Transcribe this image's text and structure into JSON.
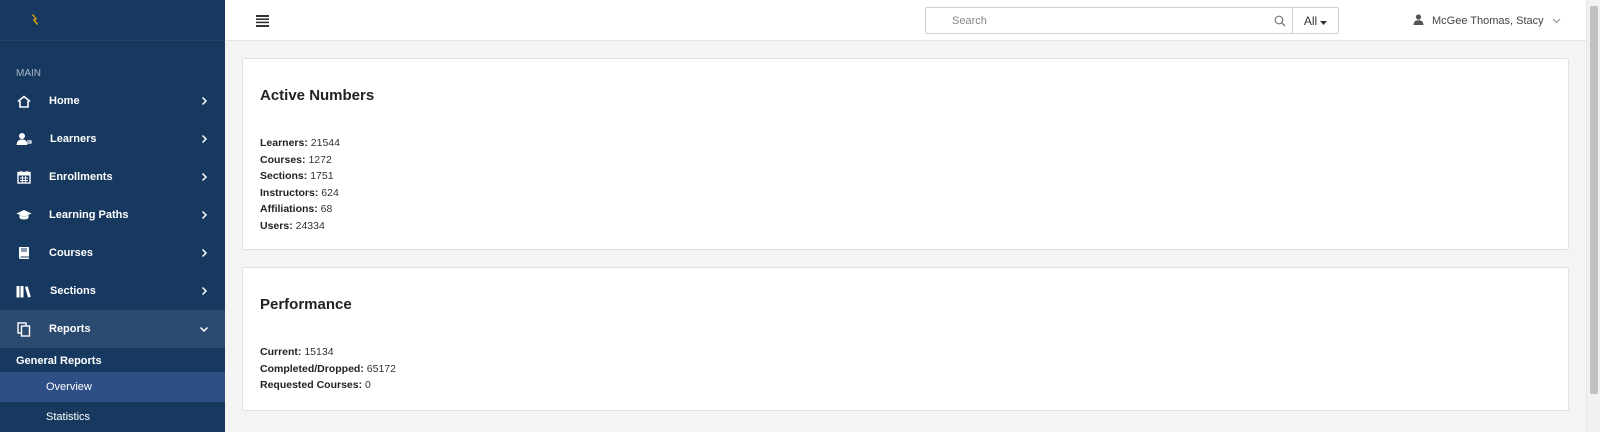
{
  "sidebar": {
    "section_label": "MAIN",
    "items": [
      {
        "label": "Home",
        "icon": "home-icon"
      },
      {
        "label": "Learners",
        "icon": "learner-icon"
      },
      {
        "label": "Enrollments",
        "icon": "calendar-icon"
      },
      {
        "label": "Learning Paths",
        "icon": "graduation-cap-icon"
      },
      {
        "label": "Courses",
        "icon": "book-icon"
      },
      {
        "label": "Sections",
        "icon": "books-icon"
      },
      {
        "label": "Reports",
        "icon": "copy-icon"
      }
    ],
    "reports_submenu": {
      "header": "General Reports",
      "items": [
        {
          "label": "Overview",
          "selected": true
        },
        {
          "label": "Statistics",
          "selected": false
        }
      ]
    }
  },
  "topbar": {
    "search_placeholder": "Search",
    "search_filter": "All",
    "user_name": "McGee Thomas, Stacy"
  },
  "cards": [
    {
      "title": "Active Numbers",
      "stats": [
        {
          "label": "Learners:",
          "value": "21544"
        },
        {
          "label": "Courses:",
          "value": "1272"
        },
        {
          "label": "Sections:",
          "value": "1751"
        },
        {
          "label": "Instructors:",
          "value": "624"
        },
        {
          "label": "Affiliations:",
          "value": "68"
        },
        {
          "label": "Users:",
          "value": "24334"
        }
      ]
    },
    {
      "title": "Performance",
      "stats": [
        {
          "label": "Current:",
          "value": "15134"
        },
        {
          "label": "Completed/Dropped:",
          "value": "65172"
        },
        {
          "label": "Requested Courses:",
          "value": "0"
        }
      ]
    }
  ],
  "colors": {
    "sidebar_bg": "#17395f",
    "sidebar_active": "#2a4a70",
    "submenu_selected": "#2d4f86",
    "logo_accent": "#e0a800"
  }
}
